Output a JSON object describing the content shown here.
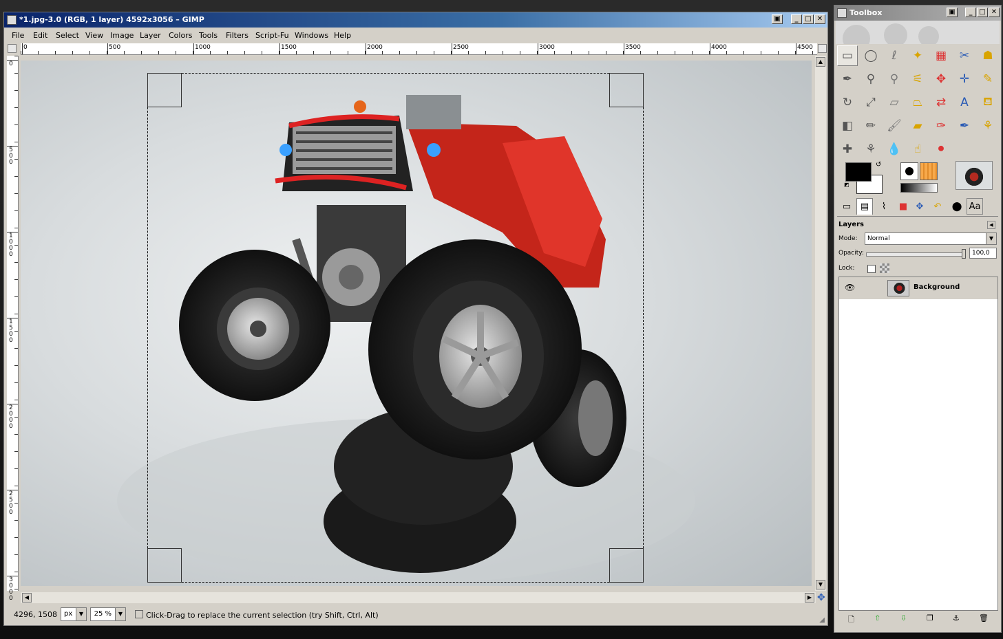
{
  "image_window": {
    "title": "*1.jpg-3.0 (RGB, 1 layer) 4592x3056 – GIMP",
    "menu": [
      "File",
      "Edit",
      "Select",
      "View",
      "Image",
      "Layer",
      "Colors",
      "Tools",
      "Filters",
      "Script-Fu",
      "Windows",
      "Help"
    ],
    "ruler_h_labels": [
      "0",
      "500",
      "1000",
      "1500",
      "2000",
      "2500",
      "3000",
      "3500",
      "4000",
      "4500"
    ],
    "ruler_v_labels": [
      "0",
      "500",
      "1000",
      "1500",
      "2000",
      "2500",
      "3000"
    ],
    "status": {
      "coords": "4296, 1508",
      "unit": "px",
      "zoom": "25 %",
      "message": "Click-Drag to replace the current selection (try Shift, Ctrl, Alt)"
    }
  },
  "toolbox": {
    "title": "Toolbox",
    "tools": [
      {
        "name": "rect-select-tool",
        "glyph": "▭"
      },
      {
        "name": "ellipse-select-tool",
        "glyph": "◯"
      },
      {
        "name": "free-select-tool",
        "glyph": "ℓ"
      },
      {
        "name": "fuzzy-select-tool",
        "glyph": "✦"
      },
      {
        "name": "color-select-tool",
        "glyph": "▦"
      },
      {
        "name": "scissors-tool",
        "glyph": "✂"
      },
      {
        "name": "foreground-select-tool",
        "glyph": "☗"
      },
      {
        "name": "paths-tool",
        "glyph": "✒"
      },
      {
        "name": "color-picker-tool",
        "glyph": "⚲"
      },
      {
        "name": "zoom-tool",
        "glyph": "⚲"
      },
      {
        "name": "measure-tool",
        "glyph": "⚟"
      },
      {
        "name": "move-tool",
        "glyph": "✥"
      },
      {
        "name": "align-tool",
        "glyph": "✛"
      },
      {
        "name": "crop-tool",
        "glyph": "✎"
      },
      {
        "name": "rotate-tool",
        "glyph": "↻"
      },
      {
        "name": "scale-tool",
        "glyph": "⤢"
      },
      {
        "name": "shear-tool",
        "glyph": "▱"
      },
      {
        "name": "perspective-tool",
        "glyph": "⏢"
      },
      {
        "name": "flip-tool",
        "glyph": "⇄"
      },
      {
        "name": "text-tool",
        "glyph": "A"
      },
      {
        "name": "bucket-fill-tool",
        "glyph": "⛾"
      },
      {
        "name": "blend-tool",
        "glyph": "◧"
      },
      {
        "name": "pencil-tool",
        "glyph": "✏"
      },
      {
        "name": "paintbrush-tool",
        "glyph": "🖌"
      },
      {
        "name": "eraser-tool",
        "glyph": "▰"
      },
      {
        "name": "airbrush-tool",
        "glyph": "✑"
      },
      {
        "name": "ink-tool",
        "glyph": "✒"
      },
      {
        "name": "clone-tool",
        "glyph": "⚘"
      },
      {
        "name": "heal-tool",
        "glyph": "✚"
      },
      {
        "name": "perspective-clone-tool",
        "glyph": "⚘"
      },
      {
        "name": "blur-tool",
        "glyph": "💧"
      },
      {
        "name": "smudge-tool",
        "glyph": "☝"
      },
      {
        "name": "dodge-burn-tool",
        "glyph": "⚫"
      }
    ],
    "colors": {
      "foreground": "#000000",
      "background": "#ffffff",
      "pattern": "#f7a94b"
    }
  },
  "layers": {
    "title": "Layers",
    "mode_label": "Mode:",
    "mode_value": "Normal",
    "opacity_label": "Opacity:",
    "opacity_value": "100,0",
    "lock_label": "Lock:",
    "items": [
      {
        "name": "Background"
      }
    ]
  }
}
